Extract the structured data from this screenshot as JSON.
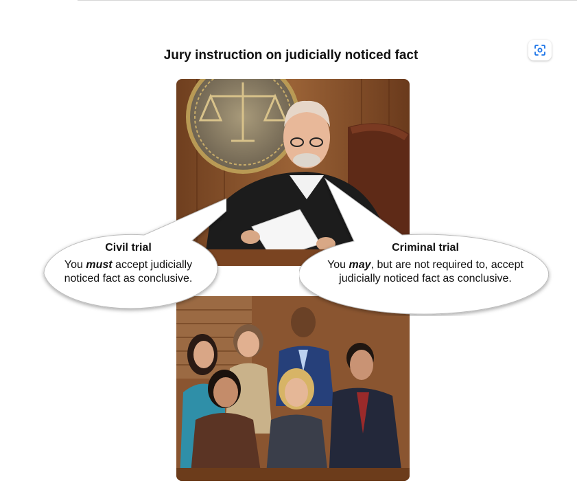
{
  "title": "Jury instruction on judicially noticed fact",
  "lens_button": {
    "icon": "visual-search-icon"
  },
  "civil": {
    "heading": "Civil trial",
    "pre": "You ",
    "emph": "must",
    "post": " accept judicially",
    "line2": "noticed fact as conclusive."
  },
  "criminal": {
    "heading": "Criminal trial",
    "pre": "You ",
    "emph": "may",
    "post": ", but are not required to, accept",
    "line2": "judicially noticed fact as conclusive."
  },
  "colors": {
    "wood": "#8a5530",
    "robe": "#1c1c1c",
    "seal": "#b99a55",
    "bubble": "#ffffff"
  }
}
